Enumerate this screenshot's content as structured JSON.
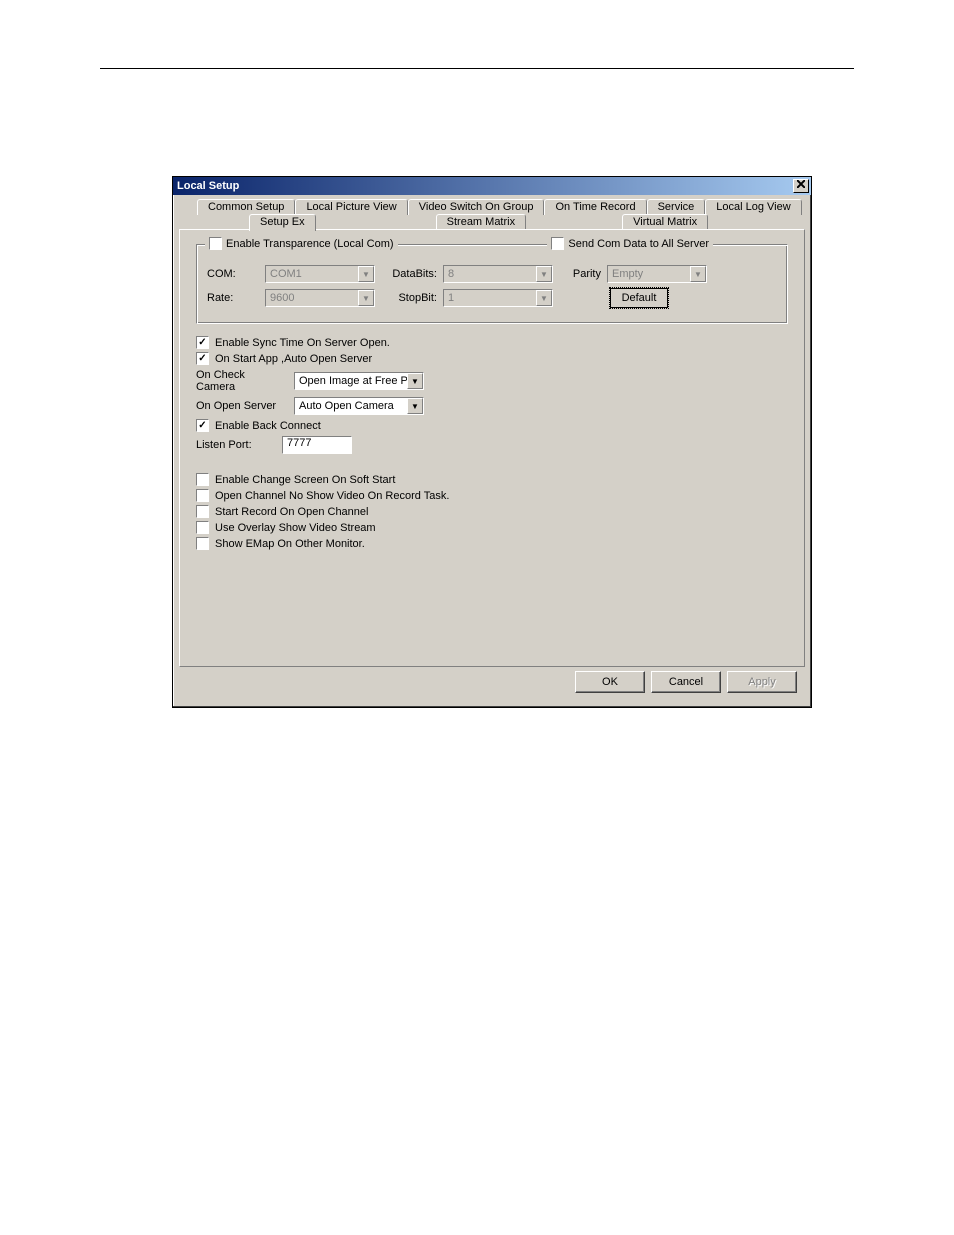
{
  "titlebar": {
    "title": "Local Setup",
    "close": "x"
  },
  "tabs": {
    "row1": [
      "Common Setup",
      "Local Picture View",
      "Video Switch On Group",
      "On Time Record",
      "Service",
      "Local Log View"
    ],
    "row2": [
      "Setup Ex",
      "Stream Matrix",
      "Virtual Matrix"
    ],
    "active": "Setup Ex"
  },
  "groupbox": {
    "left_legend": "Enable Transparence (Local Com)",
    "right_legend": "Send Com Data to All Server",
    "row1": {
      "com_label": "COM:",
      "com_value": "COM1",
      "databits_label": "DataBits:",
      "databits_value": "8",
      "parity_label": "Parity",
      "parity_value": "Empty"
    },
    "row2": {
      "rate_label": "Rate:",
      "rate_value": "9600",
      "stopbit_label": "StopBit:",
      "stopbit_value": "1",
      "default_btn": "Default"
    }
  },
  "checks": {
    "sync_time": "Enable Sync Time On Server Open.",
    "auto_open": "On Start App ,Auto Open Server",
    "on_check_camera_label": "On Check Camera",
    "on_check_camera_value": "Open Image at Free Pos",
    "on_open_server_label": "On Open Server",
    "on_open_server_value": "Auto Open Camera",
    "enable_back_connect": "Enable Back Connect",
    "listen_port_label": "Listen Port:",
    "listen_port_value": "7777",
    "enable_change_screen": "Enable Change Screen On Soft Start",
    "open_channel_noshow": "Open Channel No Show Video On Record Task.",
    "start_record": "Start Record On Open Channel",
    "use_overlay": "Use Overlay Show Video Stream",
    "show_emap": "Show EMap On Other Monitor."
  },
  "buttons": {
    "ok": "OK",
    "cancel": "Cancel",
    "apply": "Apply"
  }
}
